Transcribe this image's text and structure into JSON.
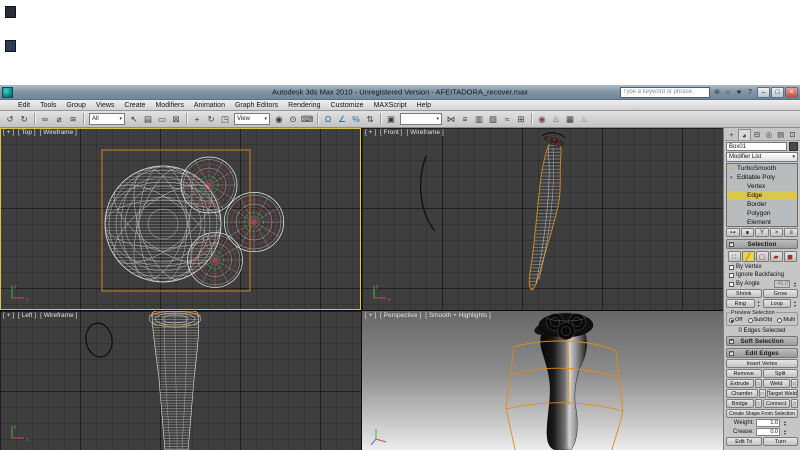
{
  "ui": {
    "dropdown_arrow": "▾",
    "spinner_up": "▴",
    "spinner_down": "▾",
    "rollout_open": "−",
    "rollout_closed": "+",
    "settings_glyph": "□"
  },
  "window": {
    "title": "Autodesk 3ds Max 2010 - Unregistered Version - AFEITADORA_recover.max",
    "search_placeholder": "Type a keyword or phrase",
    "infocenter_icons": [
      {
        "name": "infocenter-search-icon",
        "glyph": "⊚"
      },
      {
        "name": "communication-center-icon",
        "glyph": "☼"
      },
      {
        "name": "favorites-icon",
        "glyph": "★"
      },
      {
        "name": "infocenter-help-icon",
        "glyph": "?"
      }
    ],
    "window_buttons": [
      {
        "name": "minimize-button",
        "glyph": "–",
        "cls": ""
      },
      {
        "name": "maximize-button",
        "glyph": "□",
        "cls": ""
      },
      {
        "name": "close-button",
        "glyph": "×",
        "cls": "close"
      }
    ]
  },
  "menu_items": [
    "Edit",
    "Tools",
    "Group",
    "Views",
    "Create",
    "Modifiers",
    "Animation",
    "Graph Editors",
    "Rendering",
    "Customize",
    "MAXScript",
    "Help"
  ],
  "toolbar": {
    "history_icons": [
      {
        "name": "undo-icon",
        "glyph": "↺"
      },
      {
        "name": "redo-icon",
        "glyph": "↻"
      }
    ],
    "link_icons": [
      {
        "name": "select-and-link-icon",
        "glyph": "∞"
      },
      {
        "name": "unlink-selection-icon",
        "glyph": "⌀"
      },
      {
        "name": "bind-to-spacewarp-icon",
        "glyph": "≋"
      }
    ],
    "selection_filter_value": "All",
    "select_icons": [
      {
        "name": "select-object-icon",
        "glyph": "↖"
      },
      {
        "name": "select-by-name-icon",
        "glyph": "▤"
      },
      {
        "name": "rectangular-region-icon",
        "glyph": "▭"
      },
      {
        "name": "window-crossing-icon",
        "glyph": "⊠"
      }
    ],
    "transform_icons": [
      {
        "name": "select-and-move-icon",
        "glyph": "+"
      },
      {
        "name": "select-and-rotate-icon",
        "glyph": "↻"
      },
      {
        "name": "select-and-scale-icon",
        "glyph": "◳"
      }
    ],
    "ref_coord_value": "View",
    "pivot_icons": [
      {
        "name": "use-pivot-center-icon",
        "glyph": "◉"
      },
      {
        "name": "select-and-manipulate-icon",
        "glyph": "⊙"
      },
      {
        "name": "keyboard-override-icon",
        "glyph": "⌨"
      }
    ],
    "snap_icons": [
      {
        "name": "snap-toggle-icon",
        "glyph": "Ω",
        "color": "#1f5faa"
      },
      {
        "name": "angle-snap-icon",
        "glyph": "∠",
        "color": "#1f5faa"
      },
      {
        "name": "percent-snap-icon",
        "glyph": "%",
        "color": "#1f5faa"
      },
      {
        "name": "spinner-snap-icon",
        "glyph": "⇅",
        "color": "#333333"
      }
    ],
    "named_set_icons": [
      {
        "name": "edit-named-selection-sets-icon",
        "glyph": "▣"
      }
    ],
    "named_selection_value": "",
    "utility_icons": [
      {
        "name": "mirror-icon",
        "glyph": "⋈"
      },
      {
        "name": "align-icon",
        "glyph": "≡"
      },
      {
        "name": "layer-manager-icon",
        "glyph": "▥"
      },
      {
        "name": "graphite-ribbon-icon",
        "glyph": "▧"
      },
      {
        "name": "curve-editor-icon",
        "glyph": "≈"
      },
      {
        "name": "schematic-view-icon",
        "glyph": "⊞"
      }
    ],
    "render_icons": [
      {
        "name": "material-editor-icon",
        "glyph": "◉",
        "color": "#7a4a4a"
      },
      {
        "name": "render-setup-icon",
        "glyph": "♨",
        "color": "#44505a"
      },
      {
        "name": "rendered-frame-window-icon",
        "glyph": "▦"
      },
      {
        "name": "render-production-icon",
        "glyph": "♨",
        "color": "#9a7a30"
      }
    ]
  },
  "viewports": {
    "active": "top",
    "top": {
      "plus": "[ + ]",
      "label": "[ Top ]",
      "shading": "[ Wireframe ]"
    },
    "front": {
      "plus": "[ + ]",
      "label": "[ Front ]",
      "shading": "[ Wireframe ]"
    },
    "left": {
      "plus": "[ + ]",
      "label": "[ Left ]",
      "shading": "[ Wireframe ]"
    },
    "perspective": {
      "plus": "[ + ]",
      "label": "[ Perspective ]",
      "shading": "[ Smooth + Highlights ]"
    }
  },
  "panel": {
    "tabs": [
      {
        "name": "create-tab",
        "glyph": "+",
        "cls": ""
      },
      {
        "name": "modify-tab",
        "glyph": "◕",
        "cls": "active"
      },
      {
        "name": "hierarchy-tab",
        "glyph": "⊟",
        "cls": ""
      },
      {
        "name": "motion-tab",
        "glyph": "◎",
        "cls": ""
      },
      {
        "name": "display-tab",
        "glyph": "▤",
        "cls": ""
      },
      {
        "name": "utilities-tab",
        "glyph": "⊡",
        "cls": ""
      }
    ],
    "object_name": "Box01",
    "modifier_list_label": "Modifier List",
    "stack_items": [
      {
        "label": "TurboSmooth",
        "icon": "●",
        "cls": "mod",
        "iconcls": "bulb"
      },
      {
        "label": "Editable Poly",
        "icon": "▾",
        "cls": "mod",
        "iconcls": "exp"
      },
      {
        "label": "Vertex",
        "icon": "",
        "cls": "sub",
        "iconcls": ""
      },
      {
        "label": "Edge",
        "icon": "",
        "cls": "sub selected",
        "iconcls": ""
      },
      {
        "label": "Border",
        "icon": "",
        "cls": "sub",
        "iconcls": ""
      },
      {
        "label": "Polygon",
        "icon": "",
        "cls": "sub",
        "iconcls": ""
      },
      {
        "label": "Element",
        "icon": "",
        "cls": "sub",
        "iconcls": ""
      }
    ],
    "stack_tools": [
      {
        "name": "pin-stack-icon",
        "glyph": "⊶"
      },
      {
        "name": "show-end-result-icon",
        "glyph": "∎"
      },
      {
        "name": "make-unique-icon",
        "glyph": "Y"
      },
      {
        "name": "remove-modifier-icon",
        "glyph": "×"
      },
      {
        "name": "configure-modifier-sets-icon",
        "glyph": "≡"
      }
    ],
    "selection": {
      "title": "Selection",
      "modes": [
        {
          "name": "vertex-mode-icon",
          "glyph": "∷",
          "cls": ""
        },
        {
          "name": "edge-mode-icon",
          "glyph": "╱",
          "cls": "active"
        },
        {
          "name": "border-mode-icon",
          "glyph": "▢",
          "cls": ""
        },
        {
          "name": "polygon-mode-icon",
          "glyph": "▰",
          "cls": ""
        },
        {
          "name": "element-mode-icon",
          "glyph": "◼",
          "cls": ""
        }
      ],
      "by_vertex_label": "By Vertex",
      "ignore_backfacing_label": "Ignore Backfacing",
      "by_angle_label": "By Angle",
      "by_angle_value": "45.0",
      "shrink_label": "Shrink",
      "grow_label": "Grow",
      "ring_label": "Ring",
      "loop_label": "Loop",
      "preview_title": "Preview Selection",
      "preview_options": [
        {
          "label": "Off",
          "cls": "on"
        },
        {
          "label": "SubObj",
          "cls": ""
        },
        {
          "label": "Multi",
          "cls": ""
        }
      ],
      "status": "0 Edges Selected"
    },
    "soft_selection_title": "Soft Selection",
    "edit_edges": {
      "title": "Edit Edges",
      "insert_vertex": "Insert Vertex",
      "remove": "Remove",
      "split": "Split",
      "extrude": "Extrude",
      "weld": "Weld",
      "chamfer": "Chamfer",
      "target_weld": "Target Weld",
      "bridge": "Bridge",
      "connect": "Connect",
      "create_shape": "Create Shape From Selection",
      "weight_label": "Weight:",
      "weight_value": "1.0",
      "crease_label": "Crease:",
      "crease_value": "0.0",
      "edit_tri": "Edit Tri",
      "turn": "Turn"
    }
  }
}
